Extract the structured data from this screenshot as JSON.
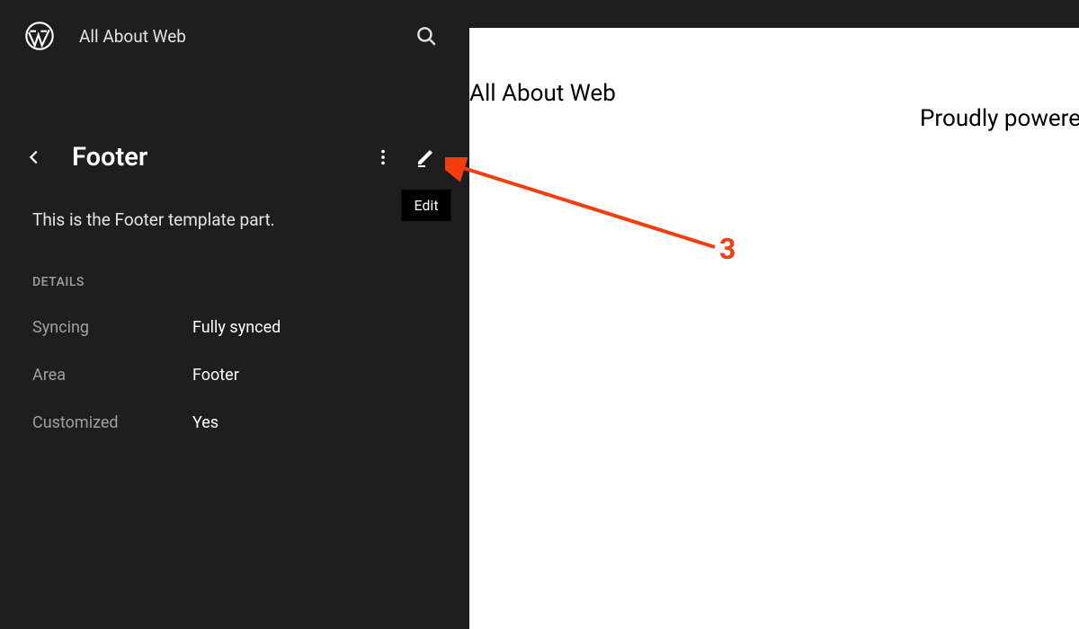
{
  "header": {
    "site_title": "All About Web"
  },
  "panel": {
    "title": "Footer",
    "description": "This is the Footer template part.",
    "edit_tooltip": "Edit",
    "section_label": "DETAILS",
    "details": [
      {
        "label": "Syncing",
        "value": "Fully synced"
      },
      {
        "label": "Area",
        "value": "Footer"
      },
      {
        "label": "Customized",
        "value": "Yes"
      }
    ]
  },
  "preview": {
    "site_title": "All About Web",
    "credit": "Proudly powere"
  },
  "annotation": {
    "number": "3"
  }
}
